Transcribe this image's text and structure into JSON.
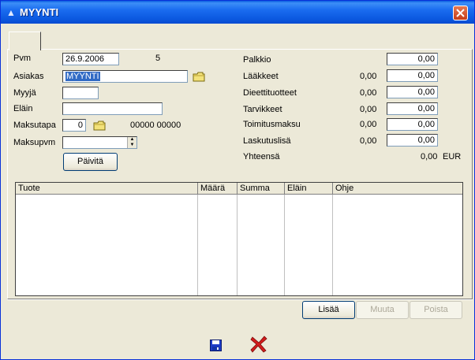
{
  "window": {
    "title": "MYYNTI"
  },
  "tabs": [
    {
      "label": ""
    }
  ],
  "left": {
    "pvm_label": "Pvm",
    "pvm_value": "26.9.2006",
    "pvm_count": "5",
    "asiakas_label": "Asiakas",
    "asiakas_value": "MYYNTI",
    "myyja_label": "Myyjä",
    "myyja_value": "",
    "elain_label": "Eläin",
    "elain_value": "",
    "maksutapa_label": "Maksutapa",
    "maksutapa_value": "0",
    "maksutapa_code": "00000 00000",
    "maksupvm_label": "Maksupvm",
    "maksupvm_value": "",
    "update_button": "Päivitä"
  },
  "right": {
    "palkkio_label": "Palkkio",
    "palkkio_value": "0,00",
    "laakkeet_label": "Lääkkeet",
    "laakkeet_base": "0,00",
    "laakkeet_value": "0,00",
    "dieetti_label": "Dieettituotteet",
    "dieetti_base": "0,00",
    "dieetti_value": "0,00",
    "tarvikkeet_label": "Tarvikkeet",
    "tarvikkeet_base": "0,00",
    "tarvikkeet_value": "0,00",
    "toimitus_label": "Toimitusmaksu",
    "toimitus_base": "0,00",
    "toimitus_value": "0,00",
    "laskutus_label": "Laskutuslisä",
    "laskutus_base": "0,00",
    "laskutus_value": "0,00",
    "yhteensa_label": "Yhteensä",
    "yhteensa_value": "0,00",
    "currency": "EUR"
  },
  "table": {
    "columns": [
      "Tuote",
      "Määrä",
      "Summa",
      "Eläin",
      "Ohje"
    ],
    "rows": []
  },
  "actions": {
    "add": "Lisää",
    "modify": "Muuta",
    "delete": "Poista"
  },
  "footer": {
    "save_icon": "save-icon",
    "cancel_icon": "cancel-x-icon"
  },
  "colors": {
    "title_bar": "#0a5ce0",
    "close_button": "#c53d19",
    "selection": "#316ac5",
    "cancel_x": "#d21c1c"
  }
}
